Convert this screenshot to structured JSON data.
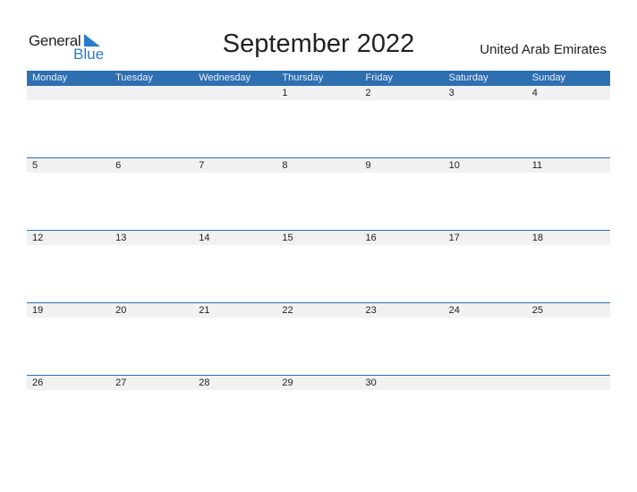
{
  "logo": {
    "general": "General",
    "blue": "Blue"
  },
  "title": "September 2022",
  "country": "United Arab Emirates",
  "colors": {
    "header": "#2e6fb0",
    "date_bar": "#f1f1f1",
    "accent": "#2a7bc8"
  },
  "weekdays": [
    "Monday",
    "Tuesday",
    "Wednesday",
    "Thursday",
    "Friday",
    "Saturday",
    "Sunday"
  ],
  "weeks": [
    [
      "",
      "",
      "",
      "1",
      "2",
      "3",
      "4"
    ],
    [
      "5",
      "6",
      "7",
      "8",
      "9",
      "10",
      "11"
    ],
    [
      "12",
      "13",
      "14",
      "15",
      "16",
      "17",
      "18"
    ],
    [
      "19",
      "20",
      "21",
      "22",
      "23",
      "24",
      "25"
    ],
    [
      "26",
      "27",
      "28",
      "29",
      "30",
      "",
      ""
    ]
  ]
}
